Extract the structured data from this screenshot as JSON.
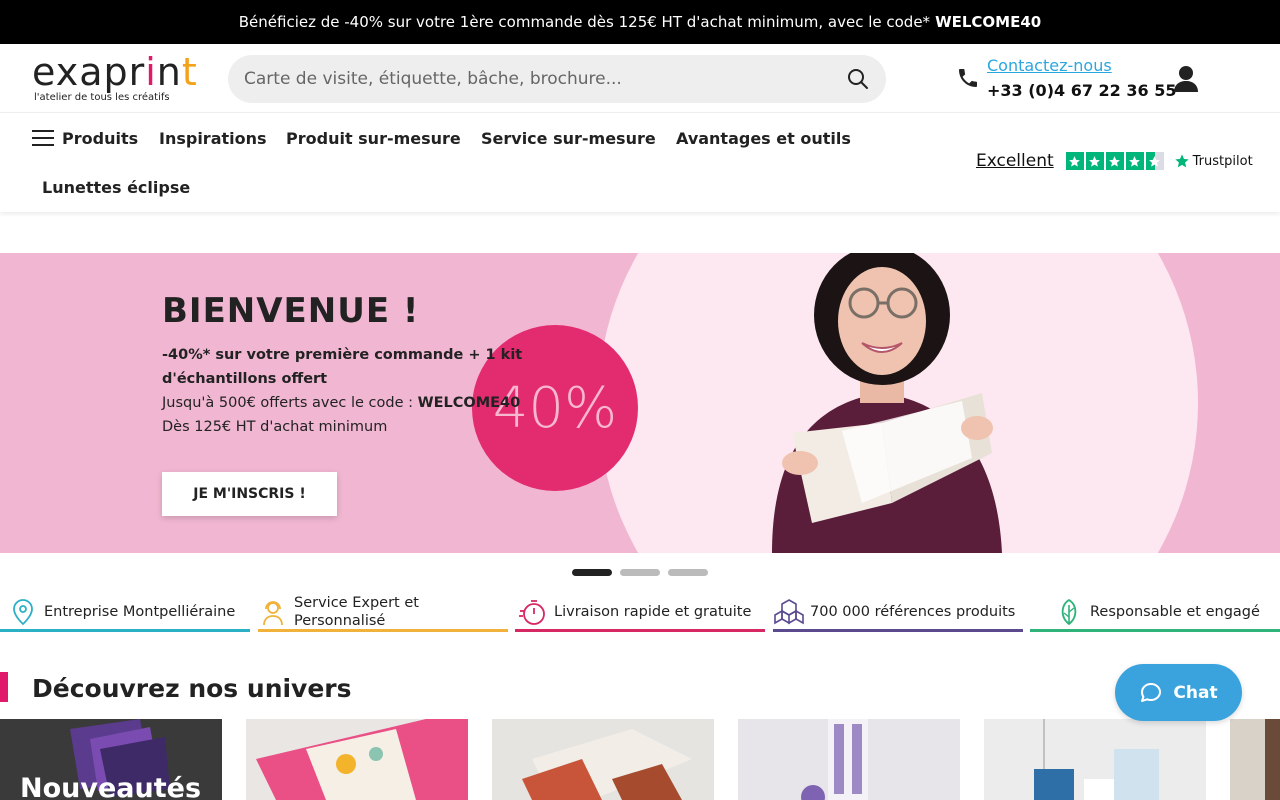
{
  "promo": {
    "text": "Bénéficiez de -40% sur votre 1ère commande dès 125€ HT d'achat minimum, avec le code*",
    "code": "WELCOME40"
  },
  "header": {
    "logo_text": "exaprint",
    "logo_tagline": "l'atelier de tous les créatifs",
    "search_placeholder": "Carte de visite, étiquette, bâche, brochure...",
    "contact_label": "Contactez-nous",
    "contact_phone": "+33 (0)4 67 22 36 55"
  },
  "nav": {
    "items": [
      "Produits",
      "Inspirations",
      "Produit sur-mesure",
      "Service sur-mesure",
      "Avantages et outils",
      "Lunettes éclipse"
    ]
  },
  "trustpilot": {
    "rating_text": "Excellent",
    "stars": 4.5,
    "brand": "Trustpilot",
    "color": "#00b67a"
  },
  "hero": {
    "title": "BIENVENUE !",
    "line1": "-40%* sur votre première commande + 1 kit",
    "line2": "d'échantillons offert",
    "line3_prefix": "Jusqu'à 500€ offerts avec le code :",
    "line3_code": "WELCOME40",
    "line4": "Dès 125€ HT d'achat minimum",
    "badge": "40%",
    "button": "JE M'INSCRIS !",
    "slides_total": 3,
    "active_slide": 1
  },
  "features": [
    {
      "label": "Entreprise Montpelliéraine",
      "icon": "location-pin-icon",
      "color": "#2bb0c6"
    },
    {
      "label_line1": "Service Expert et",
      "label_line2": "Personnalisé",
      "icon": "headset-icon",
      "color": "#f0b23a"
    },
    {
      "label": "Livraison rapide et gratuite",
      "icon": "stopwatch-icon",
      "color": "#d62862"
    },
    {
      "label": "700 000 références produits",
      "icon": "boxes-icon",
      "color": "#5b4a8e"
    },
    {
      "label": "Responsable et engagé",
      "icon": "leaf-icon",
      "color": "#2fb37a"
    }
  ],
  "universes": {
    "title": "Découvrez nos univers",
    "first_card_label": "Nouveautés"
  },
  "chat": {
    "label": "Chat"
  }
}
